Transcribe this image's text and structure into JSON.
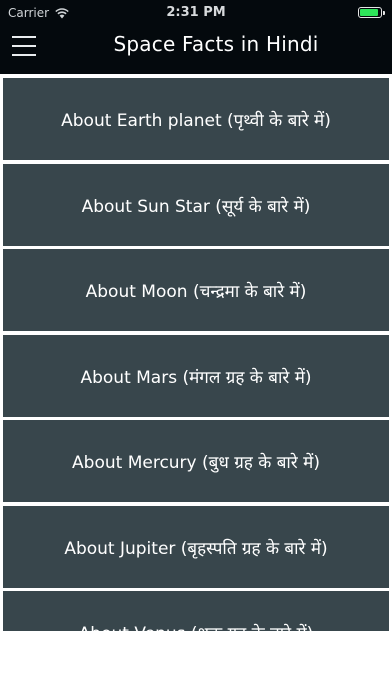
{
  "status_bar": {
    "carrier": "Carrier",
    "time": "2:31 PM",
    "battery_level": 0.9,
    "battery_color": "#2ee55a"
  },
  "nav": {
    "title": "Space Facts in Hindi",
    "menu_icon": "hamburger-menu-icon"
  },
  "colors": {
    "bar_background": "#04090d",
    "item_background": "#38464c",
    "item_text": "#ffffff"
  },
  "list": {
    "items": [
      {
        "label": "About Earth planet (पृथ्वी के बारे में)"
      },
      {
        "label": "About Sun Star (सूर्य  के बारे में)"
      },
      {
        "label": "About Moon (चन्द्रमा  के बारे में)"
      },
      {
        "label": "About Mars (मंगल ग्रह  के बारे में)"
      },
      {
        "label": "About Mercury (बुध ग्रह  के बारे में)"
      },
      {
        "label": "About Jupiter (बृहस्पति ग्रह  के बारे में)"
      },
      {
        "label": "About Venus (शुक्र ग्रह  के बारे में)"
      }
    ]
  }
}
